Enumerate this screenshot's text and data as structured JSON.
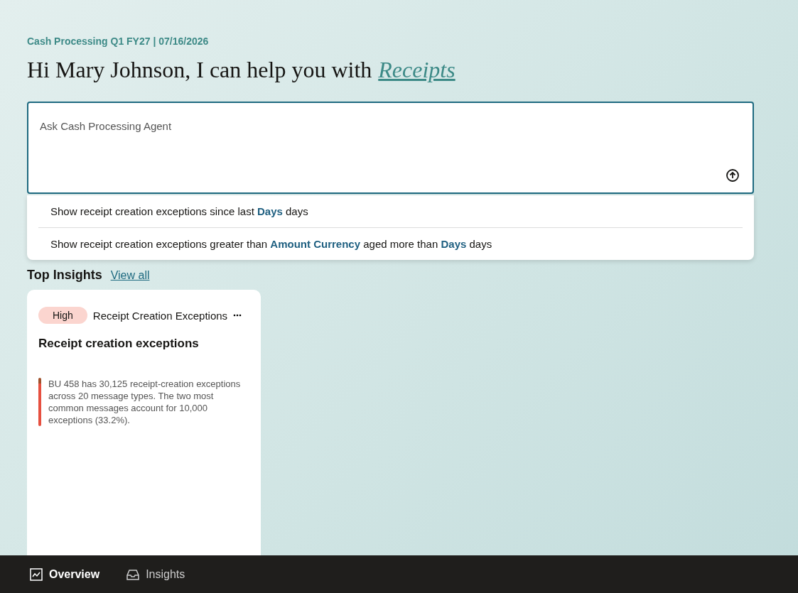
{
  "header": {
    "context": "Cash Processing Q1 FY27 | 07/16/2026",
    "greeting": "Hi Mary Johnson, I can help you with",
    "topic_link": "Receipts"
  },
  "prompt": {
    "placeholder": "Ask Cash Processing Agent"
  },
  "suggestions": [
    {
      "text": "Show receipt creation exceptions since last **Days** days"
    },
    {
      "text": "Show receipt creation exceptions greater than **Amount Currency** aged more than **Days** days"
    }
  ],
  "insights": {
    "title": "Top Insights",
    "link": "View all",
    "cards": [
      {
        "priority": "High",
        "color": "#fbd5cf",
        "category": "Receipt Creation Exceptions",
        "title": "Receipt creation exceptions",
        "summary": "BU 458 has 30,125 receipt-creation exceptions across 20 message types. The two most common messages account for 10,000 exceptions (33.2%)."
      }
    ]
  },
  "nav": [
    {
      "label": "Overview",
      "kind": "chart",
      "selected": true
    },
    {
      "label": "Insights",
      "kind": "inbox",
      "selected": false
    }
  ]
}
